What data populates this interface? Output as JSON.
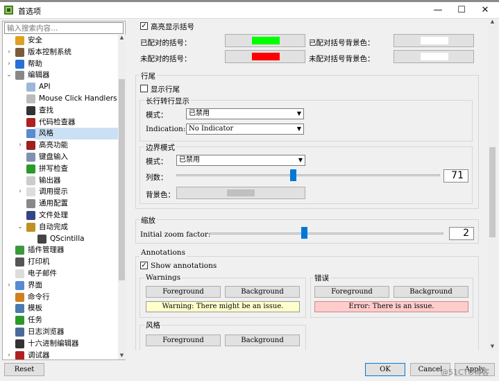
{
  "window": {
    "title": "首选项",
    "minimize": "—",
    "maximize": "☐",
    "close": "✕"
  },
  "sidebar": {
    "search_placeholder": "输入搜索内容…",
    "items": [
      {
        "label": "安全",
        "indent": 1,
        "expander": "",
        "icon": "lock-icon",
        "color": "#e0a020"
      },
      {
        "label": "版本控制系统",
        "indent": 1,
        "expander": "›",
        "icon": "vcs-icon",
        "color": "#7a5c3a"
      },
      {
        "label": "帮助",
        "indent": 1,
        "expander": "›",
        "icon": "help-icon",
        "color": "#2a6fd6"
      },
      {
        "label": "编辑器",
        "indent": 1,
        "expander": "⌄",
        "icon": "editor-icon",
        "color": "#888888"
      },
      {
        "label": "API",
        "indent": 2,
        "expander": "",
        "icon": "api-icon",
        "color": "#9bb8d8"
      },
      {
        "label": "Mouse Click Handlers",
        "indent": 2,
        "expander": "",
        "icon": "mouse-icon",
        "color": "#bbbbbb"
      },
      {
        "label": "查找",
        "indent": 2,
        "expander": "",
        "icon": "binoculars-icon",
        "color": "#333333"
      },
      {
        "label": "代码检查器",
        "indent": 2,
        "expander": "",
        "icon": "bug-icon",
        "color": "#b02020"
      },
      {
        "label": "风格",
        "indent": 2,
        "expander": "",
        "icon": "style-icon",
        "color": "#5a8ad0"
      },
      {
        "label": "高亮功能",
        "indent": 2,
        "expander": "›",
        "icon": "highlight-icon",
        "color": "#a02020"
      },
      {
        "label": "键盘输入",
        "indent": 2,
        "expander": "",
        "icon": "keyboard-icon",
        "color": "#8090b0"
      },
      {
        "label": "拼写检查",
        "indent": 2,
        "expander": "",
        "icon": "spellcheck-icon",
        "color": "#2a9a2a"
      },
      {
        "label": "输出器",
        "indent": 2,
        "expander": "",
        "icon": "exporter-icon",
        "color": "#cccccc"
      },
      {
        "label": "调用提示",
        "indent": 2,
        "expander": "›",
        "icon": "bulb-icon",
        "color": "#dddddd"
      },
      {
        "label": "通用配置",
        "indent": 2,
        "expander": "",
        "icon": "wrench-icon",
        "color": "#888888"
      },
      {
        "label": "文件处理",
        "indent": 2,
        "expander": "",
        "icon": "save-icon",
        "color": "#334488"
      },
      {
        "label": "自动完成",
        "indent": 2,
        "expander": "⌄",
        "icon": "autocomplete-icon",
        "color": "#c09020"
      },
      {
        "label": "QScintilla",
        "indent": 3,
        "expander": "",
        "icon": "qscintilla-icon",
        "color": "#444444"
      },
      {
        "label": "插件管理器",
        "indent": 1,
        "expander": "",
        "icon": "plugin-icon",
        "color": "#3a9a3a"
      },
      {
        "label": "打印机",
        "indent": 1,
        "expander": "",
        "icon": "printer-icon",
        "color": "#555555"
      },
      {
        "label": "电子邮件",
        "indent": 1,
        "expander": "",
        "icon": "email-icon",
        "color": "#dddddd"
      },
      {
        "label": "界面",
        "indent": 1,
        "expander": "›",
        "icon": "interface-icon",
        "color": "#5a8ad0"
      },
      {
        "label": "命令行",
        "indent": 1,
        "expander": "",
        "icon": "shell-icon",
        "color": "#d08020"
      },
      {
        "label": "模板",
        "indent": 1,
        "expander": "",
        "icon": "template-icon",
        "color": "#4a7ab0"
      },
      {
        "label": "任务",
        "indent": 1,
        "expander": "",
        "icon": "tasks-icon",
        "color": "#2a9a2a"
      },
      {
        "label": "日志浏览器",
        "indent": 1,
        "expander": "",
        "icon": "logviewer-icon",
        "color": "#4a6a9a"
      },
      {
        "label": "十六进制编辑器",
        "indent": 1,
        "expander": "",
        "icon": "hexeditor-icon",
        "color": "#333333"
      },
      {
        "label": "调试器",
        "indent": 1,
        "expander": "›",
        "icon": "debugger-icon",
        "color": "#b02020"
      }
    ],
    "selected_index": 8
  },
  "braces": {
    "checkbox_label": "高亮显示括号",
    "checked": true,
    "matched_label": "已配对的括号：",
    "matched_color": "#00ff00",
    "matched_bg_label": "已配对括号背景色：",
    "matched_bg_color": "#ffffff",
    "unmatched_label": "未配对的括号：",
    "unmatched_color": "#ff0000",
    "unmatched_bg_label": "未配对括号背景色：",
    "unmatched_bg_color": "#ffffff"
  },
  "eol": {
    "group_title": "行尾",
    "show_label": "显示行尾",
    "show_checked": false,
    "long_lines": {
      "group_title": "长行转行显示",
      "mode_label": "模式：",
      "mode_value": "已禁用",
      "indication_label": "Indication:",
      "indication_value": "No Indicator"
    },
    "edge": {
      "group_title": "边界模式",
      "mode_label": "模式：",
      "mode_value": "已禁用",
      "columns_label": "列数：",
      "columns_value": "71",
      "background_label": "背景色：",
      "background_color": "#c0c0c0"
    }
  },
  "zoom": {
    "group_title": "缩放",
    "label": "Initial zoom factor:",
    "value": "2"
  },
  "annotations": {
    "group_title": "Annotations",
    "show_label": "Show annotations",
    "show_checked": true,
    "warnings": {
      "title": "Warnings",
      "fg_button": "Foreground",
      "bg_button": "Background",
      "sample": "Warning: There might be an issue.",
      "sample_bg": "#ffffcc"
    },
    "errors": {
      "title": "错误",
      "fg_button": "Foreground",
      "bg_button": "Background",
      "sample": "Error: There is an issue.",
      "sample_bg": "#ffcccc"
    },
    "style": {
      "title": "风格",
      "fg_button": "Foreground",
      "bg_button": "Background"
    }
  },
  "bottom": {
    "reset": "Reset",
    "ok": "OK",
    "cancel": "Cancel",
    "apply": "Apply"
  },
  "watermark": "@51CTO博客"
}
